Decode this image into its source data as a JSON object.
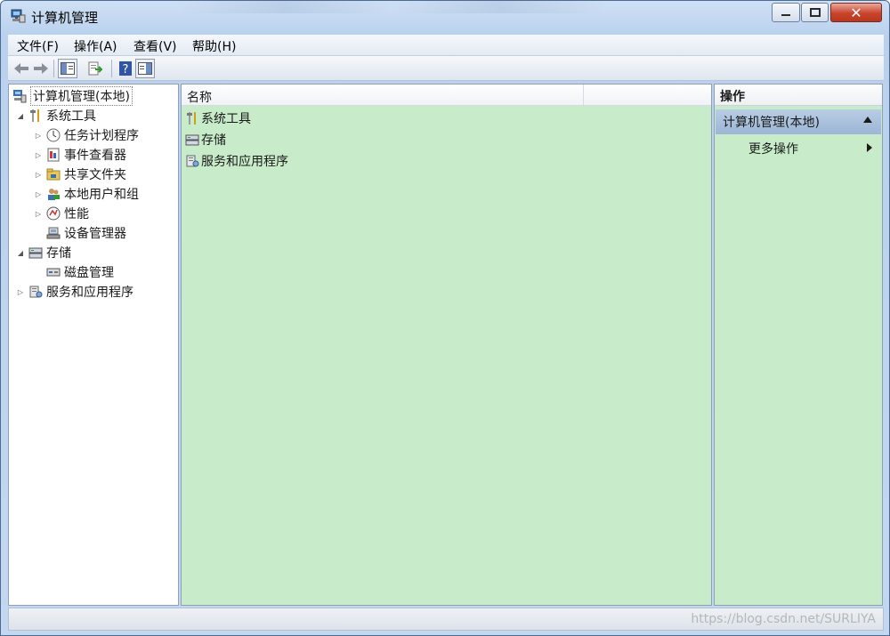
{
  "window": {
    "title": "计算机管理"
  },
  "menubar": [
    "文件(F)",
    "操作(A)",
    "查看(V)",
    "帮助(H)"
  ],
  "toolbar": {
    "icons": [
      "back-arrow-icon",
      "forward-arrow-icon",
      "show-console-tree-icon",
      "export-list-icon",
      "help-icon",
      "show-action-pane-icon"
    ]
  },
  "tree": {
    "root": "计算机管理(本地)",
    "system_tools": "系统工具",
    "task_scheduler": "任务计划程序",
    "event_viewer": "事件查看器",
    "shared_folders": "共享文件夹",
    "local_users": "本地用户和组",
    "performance": "性能",
    "device_manager": "设备管理器",
    "storage": "存储",
    "disk_management": "磁盘管理",
    "services_apps": "服务和应用程序"
  },
  "list": {
    "column_name": "名称",
    "rows": [
      "系统工具",
      "存储",
      "服务和应用程序"
    ]
  },
  "actions": {
    "title": "操作",
    "group": "计算机管理(本地)",
    "more": "更多操作"
  },
  "watermark": "https://blog.csdn.net/SURLIYA",
  "colors": {
    "pane_bg": "#c8ecc9",
    "action_group_bg": "#9db6d6",
    "close_button": "#c8432c"
  }
}
